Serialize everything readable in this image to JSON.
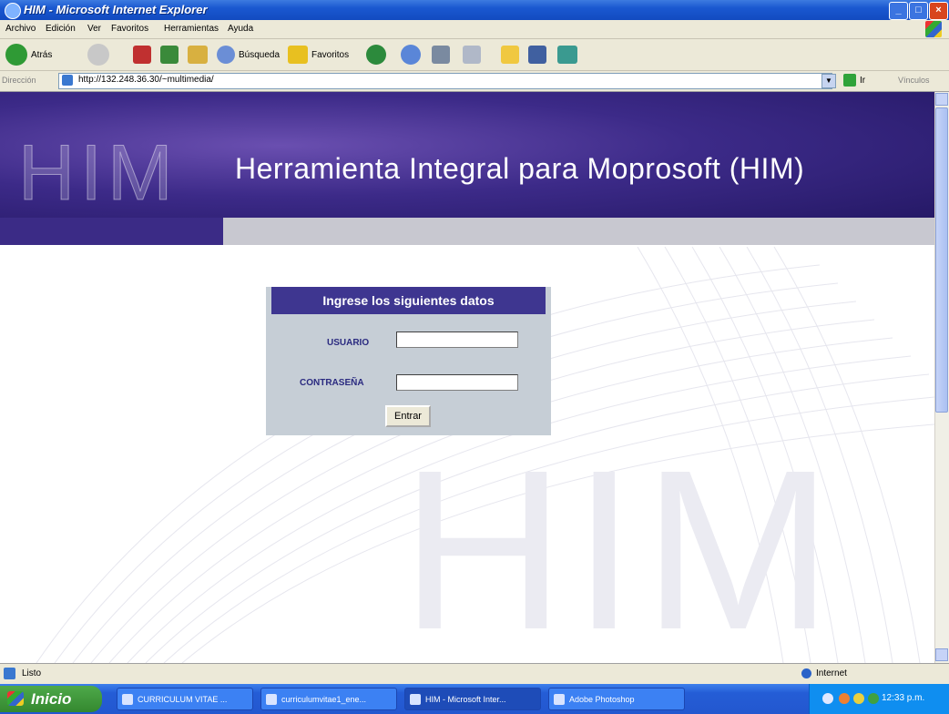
{
  "window": {
    "title": "HIM - Microsoft Internet Explorer",
    "buttons": {
      "minimize": "_",
      "maximize": "□",
      "close": "×"
    }
  },
  "menubar": [
    "Archivo",
    "Edición",
    "Ver",
    "Favoritos",
    "Herramientas",
    "Ayuda"
  ],
  "toolbar": {
    "back_label": "Atrás",
    "search_label": "Búsqueda",
    "favorites_label": "Favoritos"
  },
  "address": {
    "label": "Dirección",
    "url": "http://132.248.36.30/~multimedia/",
    "go_label": "Ir",
    "links_label": "Vínculos"
  },
  "banner": {
    "logo_text": "HIM",
    "title": "Herramienta Integral para Moprosoft (HIM)"
  },
  "watermark": "HIM",
  "form": {
    "header": "Ingrese los siguientes datos",
    "user_label": "USUARIO",
    "user_value": "",
    "password_label": "CONTRASEÑA",
    "password_value": "",
    "submit_label": "Entrar"
  },
  "statusbar": {
    "status": "Listo",
    "zone": "Internet"
  },
  "taskbar": {
    "start_label": "Inicio",
    "tasks": [
      "CURRICULUM VITAE ...",
      "curriculumvitae1_ene...",
      "HIM - Microsoft Inter...",
      "Adobe Photoshop"
    ],
    "clock": "12:33 p.m."
  },
  "colors": {
    "banner_purple": "#3c2a88",
    "form_header": "#3e3690",
    "form_bg": "#c6ced6",
    "label_blue": "#2a2a80"
  }
}
